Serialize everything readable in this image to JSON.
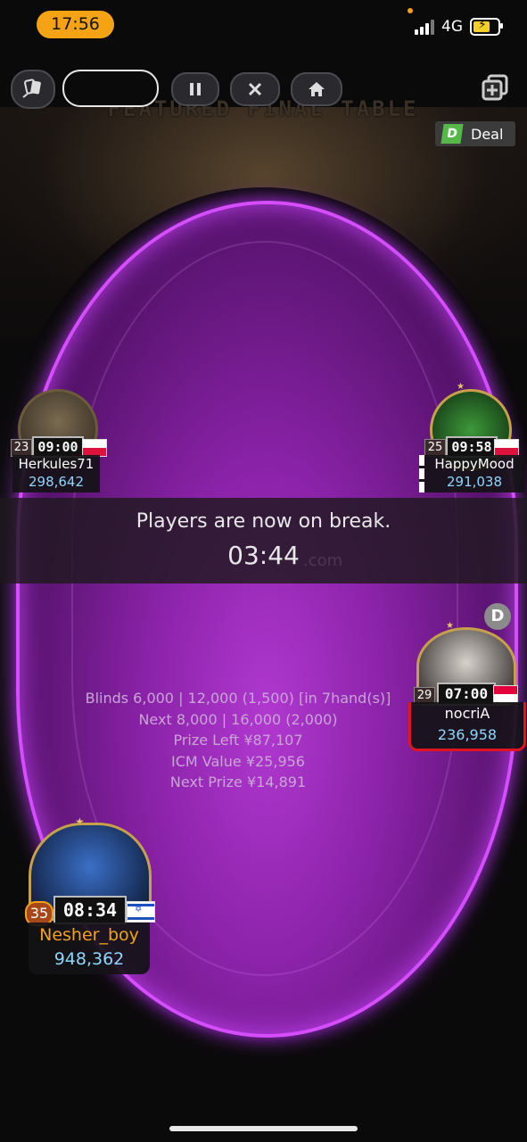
{
  "status_bar": {
    "time": "17:56",
    "network": "4G"
  },
  "toolbar": {
    "chat_icon": "chat-cards-icon",
    "pause_icon": "pause-icon",
    "close_icon": "close-icon",
    "home_icon": "home-icon",
    "add_table_icon": "add-table-icon",
    "deal_label": "Deal"
  },
  "scene": {
    "banner": "FEATURED FINAL TABLE"
  },
  "players": {
    "herkules": {
      "name": "Herkules71",
      "chips": "298,642",
      "level": "23",
      "timer": "09:00",
      "flag": "poland"
    },
    "happymood": {
      "name": "HappyMood",
      "chips": "291,038",
      "level": "25",
      "timer": "09:58",
      "flag": "poland"
    },
    "nocria": {
      "name": "nocriA",
      "chips": "236,958",
      "level": "29",
      "timer": "07:00",
      "flag": "singapore"
    },
    "nesher": {
      "name": "Nesher_boy",
      "chips": "948,362",
      "level": "35",
      "timer": "08:34",
      "flag": "israel"
    }
  },
  "break": {
    "message": "Players are now on break.",
    "countdown": "03:44",
    "watermark": ".com"
  },
  "table_info": {
    "blinds": "Blinds 6,000 | 12,000 (1,500) [in 7hand(s)]",
    "next": "Next 8,000 | 16,000 (2,000)",
    "prize_left": "Prize Left ¥87,107",
    "icm": "ICM Value ¥25,956",
    "next_prize": "Next Prize ¥14,891"
  },
  "dealer_button": "D",
  "colors": {
    "felt": "#8a22a8",
    "felt_glow": "#d64cff",
    "chips_text": "#8fd6ff",
    "hero_name": "#f5a313",
    "time_pill": "#f5a313"
  }
}
